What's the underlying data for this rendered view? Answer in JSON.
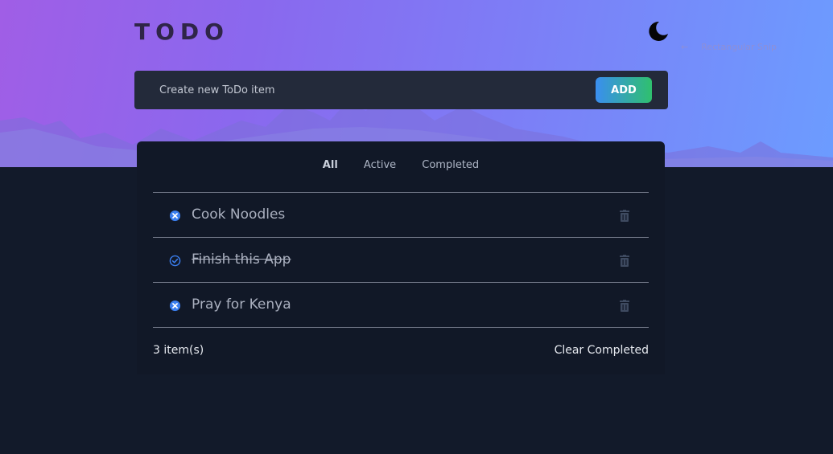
{
  "app": {
    "title": "TODO"
  },
  "header": {
    "theme_toggle_icon": "moon-icon",
    "overlay_arrow": "←",
    "overlay_text": "Rectangular Snip"
  },
  "create": {
    "placeholder": "Create new ToDo item",
    "add_label": "ADD"
  },
  "filters": [
    {
      "label": "All",
      "active": true
    },
    {
      "label": "Active",
      "active": false
    },
    {
      "label": "Completed",
      "active": false
    }
  ],
  "todos": [
    {
      "text": "Cook Noodles",
      "completed": false,
      "status_icon": "x-circle-icon",
      "delete_icon": "trash-icon"
    },
    {
      "text": "Finish this App",
      "completed": true,
      "status_icon": "check-circle-icon",
      "delete_icon": "trash-icon"
    },
    {
      "text": "Pray for Kenya",
      "completed": false,
      "status_icon": "x-circle-icon",
      "delete_icon": "trash-icon"
    }
  ],
  "footer": {
    "count_label": "3 item(s)",
    "clear_label": "Clear Completed"
  },
  "colors": {
    "background": "#121a2a",
    "card": "#111827",
    "accent_blue": "#3b7ff0",
    "accent_green": "#2fc06e",
    "hero_start": "#a05ee6",
    "hero_end": "#6c9cff"
  }
}
